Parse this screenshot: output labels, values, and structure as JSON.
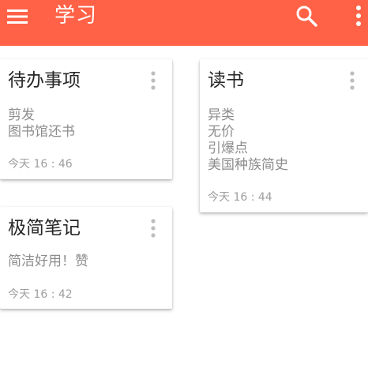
{
  "header": {
    "title": "学习",
    "menu_icon": "menu-icon",
    "search_icon": "search-icon",
    "more_icon": "more-vertical-icon",
    "background_color": "#ff6247"
  },
  "notes": [
    {
      "title": "待办事项",
      "lines": [
        "剪发",
        "图书馆还书"
      ],
      "time": "今天 16 : 46"
    },
    {
      "title": "读书",
      "lines": [
        "异类",
        "无价",
        "引爆点",
        "美国种族简史"
      ],
      "time": "今天 16 : 44"
    },
    {
      "title": "极简笔记",
      "lines": [
        "简洁好用！赞"
      ],
      "time": "今天 16 : 42"
    }
  ]
}
